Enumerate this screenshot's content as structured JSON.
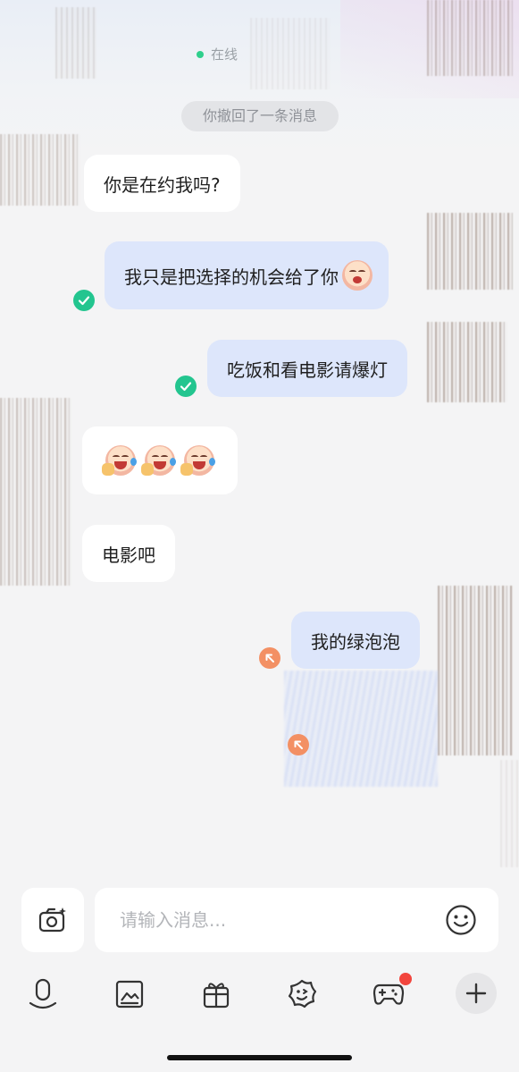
{
  "header": {
    "status_text": "在线"
  },
  "chat": {
    "system_notice": "你撤回了一条消息",
    "messages": [
      {
        "from": "other",
        "text": "你是在约我吗?"
      },
      {
        "from": "me",
        "text": "我只是把选择的机会给了你",
        "status": "read"
      },
      {
        "from": "me",
        "text": "吃饭和看电影请爆灯",
        "status": "read"
      },
      {
        "from": "other",
        "type": "emoji",
        "emoji": "laughing-crying-face"
      },
      {
        "from": "other",
        "text": "电影吧"
      },
      {
        "from": "me",
        "text": "我的绿泡泡",
        "status": "failed"
      }
    ]
  },
  "composer": {
    "placeholder": "请输入消息..."
  },
  "toolbar": {
    "items": [
      {
        "icon": "microphone-icon"
      },
      {
        "icon": "image-icon"
      },
      {
        "icon": "gift-icon"
      },
      {
        "icon": "sticker-icon"
      },
      {
        "icon": "game-icon",
        "badge": true
      },
      {
        "icon": "plus-icon"
      }
    ]
  },
  "colors": {
    "outgoing_bubble": "#dde6fb",
    "incoming_bubble": "#ffffff",
    "read_check": "#23c58f",
    "failed_status": "#f39064",
    "badge": "#f2453d"
  }
}
